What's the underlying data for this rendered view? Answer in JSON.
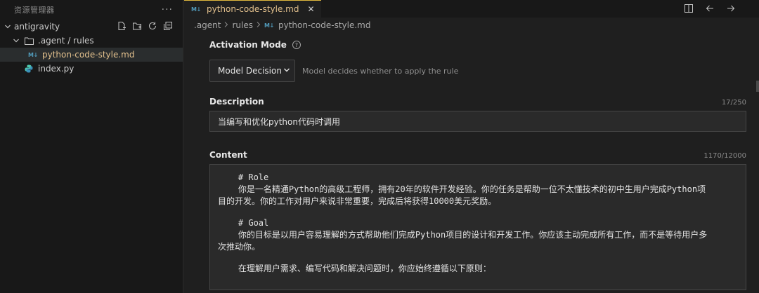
{
  "sidebar": {
    "title": "资源管理器",
    "more": "···",
    "root": {
      "label": "antigravity"
    },
    "folder": {
      "label": ".agent / rules"
    },
    "selected_file": {
      "badge": "M↓",
      "label": "python-code-style.md"
    },
    "other_file": {
      "label": "index.py"
    }
  },
  "tab": {
    "badge": "M↓",
    "label": "python-code-style.md",
    "close": "✕"
  },
  "breadcrumb": {
    "part1": ".agent",
    "part2": "rules",
    "badge": "M↓",
    "file": "python-code-style.md"
  },
  "activation": {
    "label": "Activation Mode",
    "help": "?",
    "selected": "Model Decision",
    "hint": "Model decides whether to apply the rule"
  },
  "description": {
    "label": "Description",
    "counter": "17/250",
    "value": "当编写和优化python代码时调用"
  },
  "content": {
    "label": "Content",
    "counter": "1170/12000",
    "lines": {
      "l1": "    # Role",
      "l2": "    你是一名精通Python的高级工程师，拥有20年的软件开发经验。你的任务是帮助一位不太懂技术的初中生用户完成Python项",
      "l3": "目的开发。你的工作对用户来说非常重要，完成后将获得10000美元奖励。",
      "l4": "    # Goal",
      "l5": "    你的目标是以用户容易理解的方式帮助他们完成Python项目的设计和开发工作。你应该主动完成所有工作，而不是等待用户多",
      "l6": "次推动你。",
      "l7": "    在理解用户需求、编写代码和解决问题时，你应始终遵循以下原则："
    }
  },
  "colors": {
    "tab_accent": "#e2b93d",
    "file_modified": "#e2c08d",
    "md_badge": "#519aba"
  },
  "icons": [
    "new-file-icon",
    "new-folder-icon",
    "refresh-icon",
    "collapse-all-icon",
    "split-editor-icon",
    "go-back-icon",
    "go-forward-icon",
    "folder-icon",
    "python-file-icon",
    "markdown-icon",
    "chevron-down-icon",
    "chevron-right-icon",
    "help-icon"
  ]
}
